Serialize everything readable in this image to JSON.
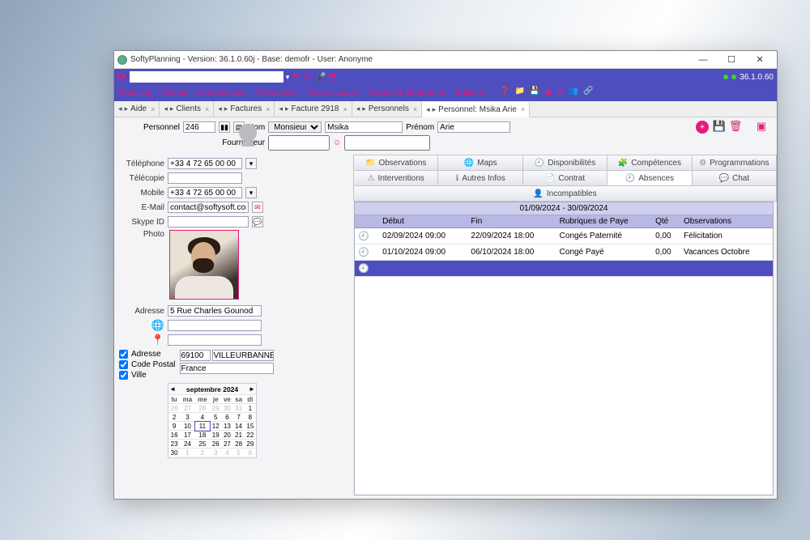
{
  "title": "SoftyPlanning - Version: 36.1.0.60j - Base: demofr - User: Anonyme",
  "version_badge": "36.1.0.60",
  "menu": [
    "Planning",
    "Clients",
    "Interventions",
    "Personnels",
    "Fournisseurs",
    "Tables de Référence",
    "Editions"
  ],
  "tabs": [
    {
      "label": "Aide"
    },
    {
      "label": "Clients"
    },
    {
      "label": "Factures"
    },
    {
      "label": "Facture 2918"
    },
    {
      "label": "Personnels"
    },
    {
      "label": "Personnel: Msika Arie",
      "active": true
    }
  ],
  "head": {
    "lbl_personnel": "Personnel",
    "id": "246",
    "lbl_nom": "Nom",
    "civ": "Monsieur",
    "nom": "Msika",
    "lbl_prenom": "Prénom",
    "prenom": "Arie",
    "lbl_fournisseur": "Fournisseur",
    "fournisseur": ""
  },
  "contact": {
    "lbl_tel": "Téléphone",
    "tel": "+33 4 72 65 00 00",
    "lbl_fax": "Télécopie",
    "fax": "",
    "lbl_mobile": "Mobile",
    "mobile": "+33 4 72 65 00 00",
    "lbl_email": "E-Mail",
    "email": "contact@softysoft.com",
    "lbl_skype": "Skype ID",
    "skype": "",
    "lbl_photo": "Photo",
    "lbl_adresse": "Adresse",
    "adresse": "5 Rue Charles Gounod",
    "cp": "69100",
    "ville": "VILLEURBANNE",
    "pays": "France"
  },
  "checks": {
    "adresse": "Adresse",
    "cp": "Code Postal",
    "ville": "Ville"
  },
  "cal": {
    "title": "septembre 2024",
    "dow": [
      "lu",
      "ma",
      "me",
      "je",
      "ve",
      "sa",
      "di"
    ],
    "rows": [
      [
        "26",
        "27",
        "28",
        "29",
        "30",
        "31",
        "1"
      ],
      [
        "2",
        "3",
        "4",
        "5",
        "6",
        "7",
        "8"
      ],
      [
        "9",
        "10",
        "11",
        "12",
        "13",
        "14",
        "15"
      ],
      [
        "16",
        "17",
        "18",
        "19",
        "20",
        "21",
        "22"
      ],
      [
        "23",
        "24",
        "25",
        "26",
        "27",
        "28",
        "29"
      ],
      [
        "30",
        "1",
        "2",
        "3",
        "4",
        "5",
        "6"
      ]
    ]
  },
  "subtabs_row1": [
    {
      "icon": "📁",
      "label": "Observations"
    },
    {
      "icon": "🌐",
      "label": "Maps"
    },
    {
      "icon": "🕘",
      "label": "Disponibilités"
    },
    {
      "icon": "🧩",
      "label": "Compétences"
    },
    {
      "icon": "⚙",
      "label": "Programmations"
    }
  ],
  "subtabs_row2": [
    {
      "icon": "⚠",
      "label": "Interventions"
    },
    {
      "icon": "ℹ",
      "label": "Autres Infos"
    },
    {
      "icon": "📄",
      "label": "Contrat"
    },
    {
      "icon": "🕘",
      "label": "Absences",
      "active": true
    },
    {
      "icon": "💬",
      "label": "Chat"
    },
    {
      "icon": "👤",
      "label": "Incompatibles"
    }
  ],
  "absences": {
    "range": "01/09/2024 - 30/09/2024",
    "cols": [
      "",
      "Début",
      "Fin",
      "Rubriques de Paye",
      "Qté",
      "Observations"
    ],
    "rows": [
      {
        "debut": "02/09/2024 09:00",
        "fin": "22/09/2024 18:00",
        "rub": "Congés Paternité",
        "qte": "0,00",
        "obs": "Félicitation"
      },
      {
        "debut": "01/10/2024 09:00",
        "fin": "06/10/2024 18:00",
        "rub": "Congé Payé",
        "qte": "0,00",
        "obs": "Vacances Octobre"
      }
    ]
  }
}
